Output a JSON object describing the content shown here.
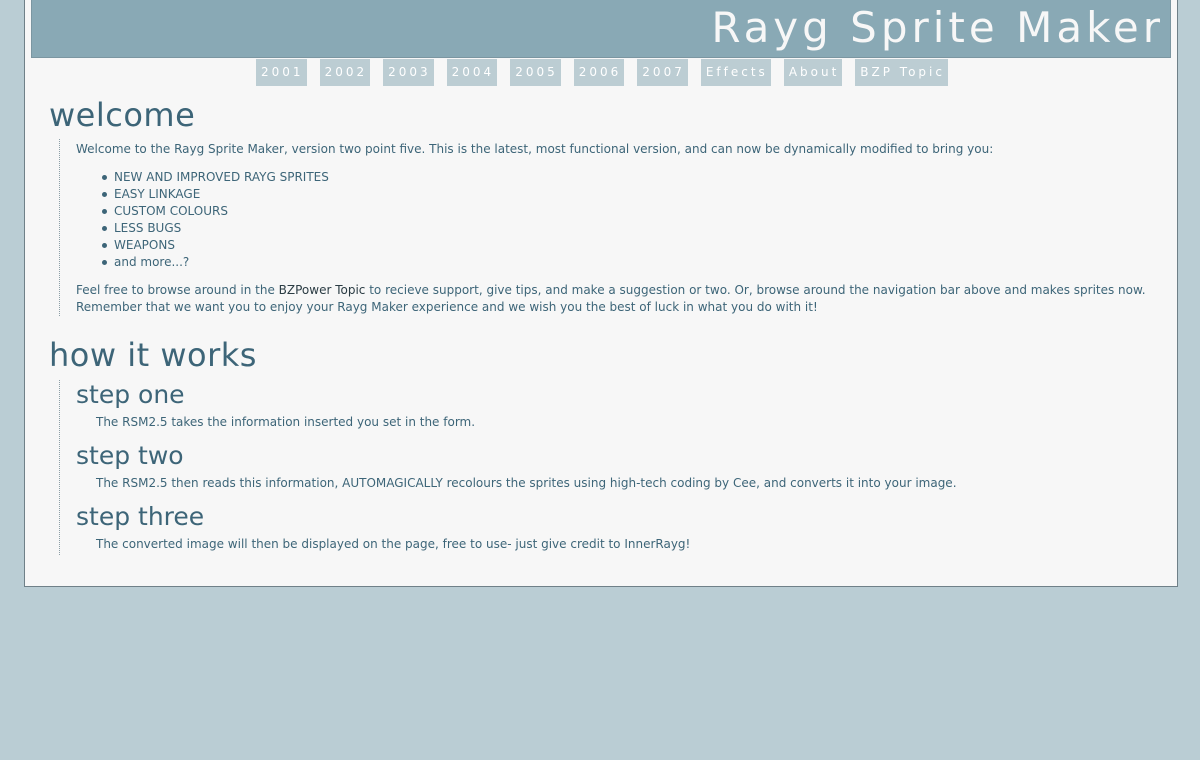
{
  "site": {
    "title": "Rayg Sprite Maker"
  },
  "nav": [
    {
      "label": "2001"
    },
    {
      "label": "2002"
    },
    {
      "label": "2003"
    },
    {
      "label": "2004"
    },
    {
      "label": "2005"
    },
    {
      "label": "2006"
    },
    {
      "label": "2007"
    },
    {
      "label": "Effects"
    },
    {
      "label": "About"
    },
    {
      "label": "BZP Topic"
    }
  ],
  "welcome": {
    "heading": "welcome",
    "intro": "Welcome to the Rayg Sprite Maker, version two point five. This is the latest, most functional version, and can now be dynamically modified to bring you:",
    "bullets": [
      "NEW AND IMPROVED RAYG SPRITES",
      "EASY LINKAGE",
      "CUSTOM COLOURS",
      "LESS BUGS",
      "WEAPONS",
      "and more...?"
    ],
    "outro_before": "Feel free to browse around in the ",
    "outro_link": "BZPower Topic",
    "outro_after": " to recieve support, give tips, and make a suggestion or two. Or, browse around the navigation bar above and makes sprites now. Remember that we want you to enjoy your Rayg Maker experience and we wish you the best of luck in what you do with it!"
  },
  "how": {
    "heading": "how it works",
    "steps": [
      {
        "title": "step one",
        "text": "The RSM2.5 takes the information inserted you set in the form."
      },
      {
        "title": "step two",
        "text": "The RSM2.5 then reads this information, AUTOMAGICALLY recolours the sprites using high-tech coding by Cee, and converts it into your image."
      },
      {
        "title": "step three",
        "text": "The converted image will then be displayed on the page, free to use- just give credit to InnerRayg!"
      }
    ]
  },
  "colors": {
    "background": "#bacdd4",
    "header": "#89a9b5",
    "nav_button": "#bccdd3",
    "heading_text": "#3d6578",
    "page": "#f7f7f7"
  }
}
